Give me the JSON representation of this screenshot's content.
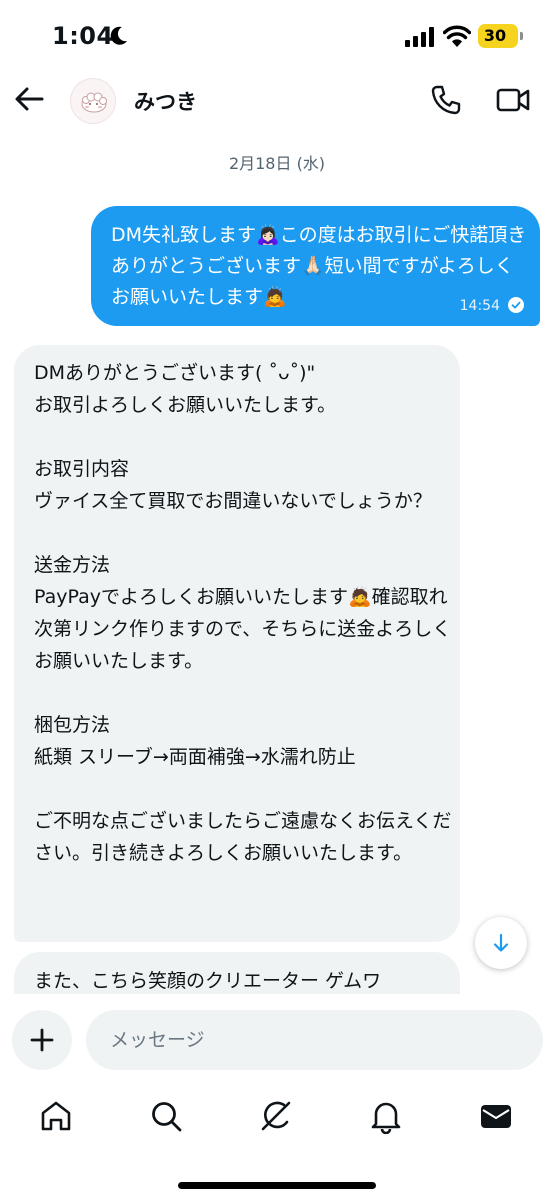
{
  "status_bar": {
    "time": "1:04",
    "battery": "30"
  },
  "header": {
    "contact_name": "みつき"
  },
  "conversation": {
    "date": "2月18日 (水)",
    "outgoing": {
      "text": "DM失礼致します🙇🏻‍♀️この度はお取引にご快諾頂きありがとうございます🙏🏻短い間ですがよろしくお願いいたします🙇",
      "time": "14:54"
    },
    "incoming": {
      "text": "DMありがとうございます( ˚ᴗ˚)\"\nお取引よろしくお願いいたします。\n\nお取引内容\nヴァイス全て買取でお間違いないでしょうか？\n\n送金方法\nPayPayでよろしくお願いいたします🙇確認取れ次第リンク作りますので、そちらに送金よろしくお願いいたします。\n\n梱包方法\n紙類 スリーブ→両面補強→水濡れ防止\n\nご不明な点ございましたらご遠慮なくお伝えください。引き続きよろしくお願いいたします。"
    },
    "incoming_partial": {
      "text": "また、こちら笑顔のクリエーター ゲムワ"
    }
  },
  "composer": {
    "placeholder": "メッセージ"
  },
  "colors": {
    "accent": "#1d9bf0",
    "incoming_bubble": "#eff3f4",
    "battery": "#f6d31f"
  },
  "icons": [
    "moon-icon",
    "signal-icon",
    "wifi-icon",
    "back-arrow-icon",
    "phone-icon",
    "video-icon",
    "read-check-icon",
    "arrow-down-icon",
    "plus-icon",
    "home-icon",
    "search-icon",
    "grok-icon",
    "bell-icon",
    "mail-icon"
  ]
}
